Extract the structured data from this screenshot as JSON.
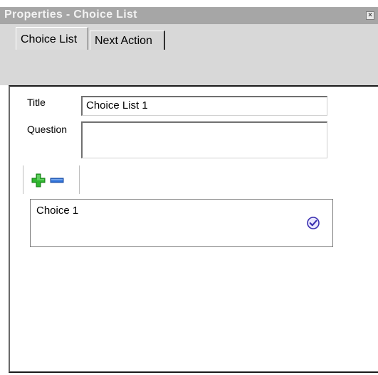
{
  "window": {
    "title": "Properties - Choice List",
    "close_glyph": "×"
  },
  "tabs": [
    {
      "label": "Choice List",
      "active": true
    },
    {
      "label": "Next Action",
      "active": false
    }
  ],
  "form": {
    "title_label": "Title",
    "title_value": "Choice List 1",
    "question_label": "Question",
    "question_value": ""
  },
  "toolbar": {
    "add_icon": "plus-icon",
    "remove_icon": "minus-icon"
  },
  "choices": [
    {
      "label": "Choice 1",
      "icon": "check-circle-icon"
    }
  ],
  "colors": {
    "titlebar": "#a6a6a6",
    "tab_area": "#d8d8d8",
    "add_green": "#2fb52f",
    "remove_blue": "#2f72d8",
    "check_purple": "#3a2fb0"
  }
}
